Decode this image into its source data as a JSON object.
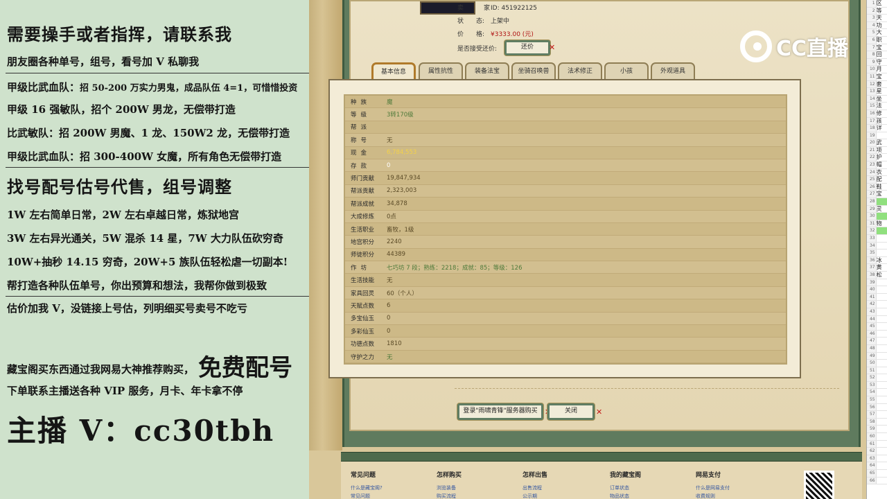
{
  "overlay": {
    "l1": "需要操手或者指挥，请联系我",
    "l2": "朋友圈各种单号，组号，看号加 V 私聊我",
    "l3_a": "甲级比武血队：",
    "l3_b": "招 50-200 万实力男鬼，成品队伍 4=1，可惜惜投资",
    "l4": "甲级 16 强敏队，招个 200W 男龙，无偿带打造",
    "l5": "比武敏队：招 200W 男魔、1 龙、150W2 龙，无偿带打造",
    "l6": "甲级比武血队：招 300-400W 女魔，所有角色无偿带打造",
    "l7": "找号配号估号代售，组号调整",
    "l8": "1W 左右简单日常，2W 左右卓越日常，炼狱地宫",
    "l9": "3W 左右异光通关，5W 混杀 14 星，7W 大力队伍砍穷奇",
    "l10": "10W+抽秒 14.15 穷奇，20W+5 族队伍轻松虐一切副本!",
    "l11": "帮打造各种队伍单号，你出预算和想法，我帮你做到极致",
    "l12": "估价加我 V，没链接上号估，列明细买号卖号不吃亏",
    "l13_a": "藏宝阁买东西通过我网易大神推荐购买，",
    "l13_b": "免费配号",
    "l14": "下单联系主播送各种 VIP 服务，月卡、年卡拿不停",
    "l15": "主播 V：cc30tbh"
  },
  "header": {
    "seller_label": "卖　家",
    "seller_value": "ID:  451922125",
    "status_label": "状　　态:",
    "status_value": "上架中",
    "price_label": "价　　格:",
    "price_value": "¥3333.00 (元)",
    "counter_label": "是否接受还价:",
    "counter_button": "还价"
  },
  "tabs": [
    "基本信息",
    "属性抗性",
    "装备法宝",
    "坐骑召唤兽",
    "法术修正",
    "小孩",
    "外观道具"
  ],
  "rows": [
    {
      "label": "种族",
      "value": "魔",
      "style": "green"
    },
    {
      "label": "等级",
      "value": "3转170级",
      "style": "green"
    },
    {
      "label": "帮派",
      "value": "",
      "style": ""
    },
    {
      "label": "称号",
      "value": "无",
      "style": ""
    },
    {
      "label": "现金",
      "value": "6,784,553",
      "style": "yellow"
    },
    {
      "label": "存款",
      "value": "0",
      "style": "white"
    },
    {
      "label": "师门贡献",
      "value": "19,847,934",
      "style": ""
    },
    {
      "label": "帮派贡献",
      "value": "2,323,003",
      "style": ""
    },
    {
      "label": "帮派成就",
      "value": "34,878",
      "style": ""
    },
    {
      "label": "大成修炼",
      "value": "0点",
      "style": ""
    },
    {
      "label": "生活职业",
      "value": "畜牧，1级",
      "style": ""
    },
    {
      "label": "地宫积分",
      "value": "2240",
      "style": ""
    },
    {
      "label": "师徒积分",
      "value": "44389",
      "style": ""
    },
    {
      "label": "作坊",
      "value": "七巧坊 7 段；熟练：2218；成就：85；等级：126",
      "style": "green"
    },
    {
      "label": "生活技能",
      "value": "无",
      "style": ""
    },
    {
      "label": "家具回灵",
      "value": "60（个人）",
      "style": ""
    },
    {
      "label": "天赋点数",
      "value": "6",
      "style": ""
    },
    {
      "label": "多宝仙玉",
      "value": "0",
      "style": ""
    },
    {
      "label": "多彩仙玉",
      "value": "0",
      "style": ""
    },
    {
      "label": "功德点数",
      "value": "1810",
      "style": ""
    },
    {
      "label": "守护之力",
      "value": "无",
      "style": "green"
    }
  ],
  "buttons": {
    "login_buy": "登录\"雨啸青锋\"服务器购买",
    "close": "关闭"
  },
  "footer": {
    "c1_title": "常见问题",
    "c1_l1": "什么是藏宝阁?",
    "c1_l2": "常见问题",
    "c2_title": "怎样购买",
    "c2_l1": "浏览装备",
    "c2_l2": "购买流程",
    "c3_title": "怎样出售",
    "c3_l1": "出售流程",
    "c3_l2": "公示期",
    "c4_title": "我的藏宝阁",
    "c4_l1": "订单状态",
    "c4_l2": "物品状态",
    "c5_title": "网易支付",
    "c5_l1": "什么是网易支付",
    "c5_l2": "收费规则"
  },
  "logo": {
    "text": "CC直播"
  },
  "sheet": {
    "rows": [
      "区",
      "等",
      "天",
      "功",
      "大",
      "职",
      "宝",
      "回",
      "守",
      "月",
      "宝",
      "套",
      "星",
      "坐",
      "法",
      "修",
      "孩",
      "详",
      "",
      "武",
      "项",
      "护",
      "帽",
      "衣",
      "配",
      "鞋",
      "宝",
      "",
      "灵",
      "",
      "物",
      "",
      "",
      "",
      "",
      "冰",
      "黄",
      "松",
      "",
      "",
      "",
      "",
      "",
      "",
      "",
      "",
      "",
      "",
      "",
      "",
      "",
      "",
      "",
      "",
      "",
      "",
      "",
      "",
      "",
      "",
      "",
      "",
      "",
      "",
      "",
      ""
    ]
  }
}
